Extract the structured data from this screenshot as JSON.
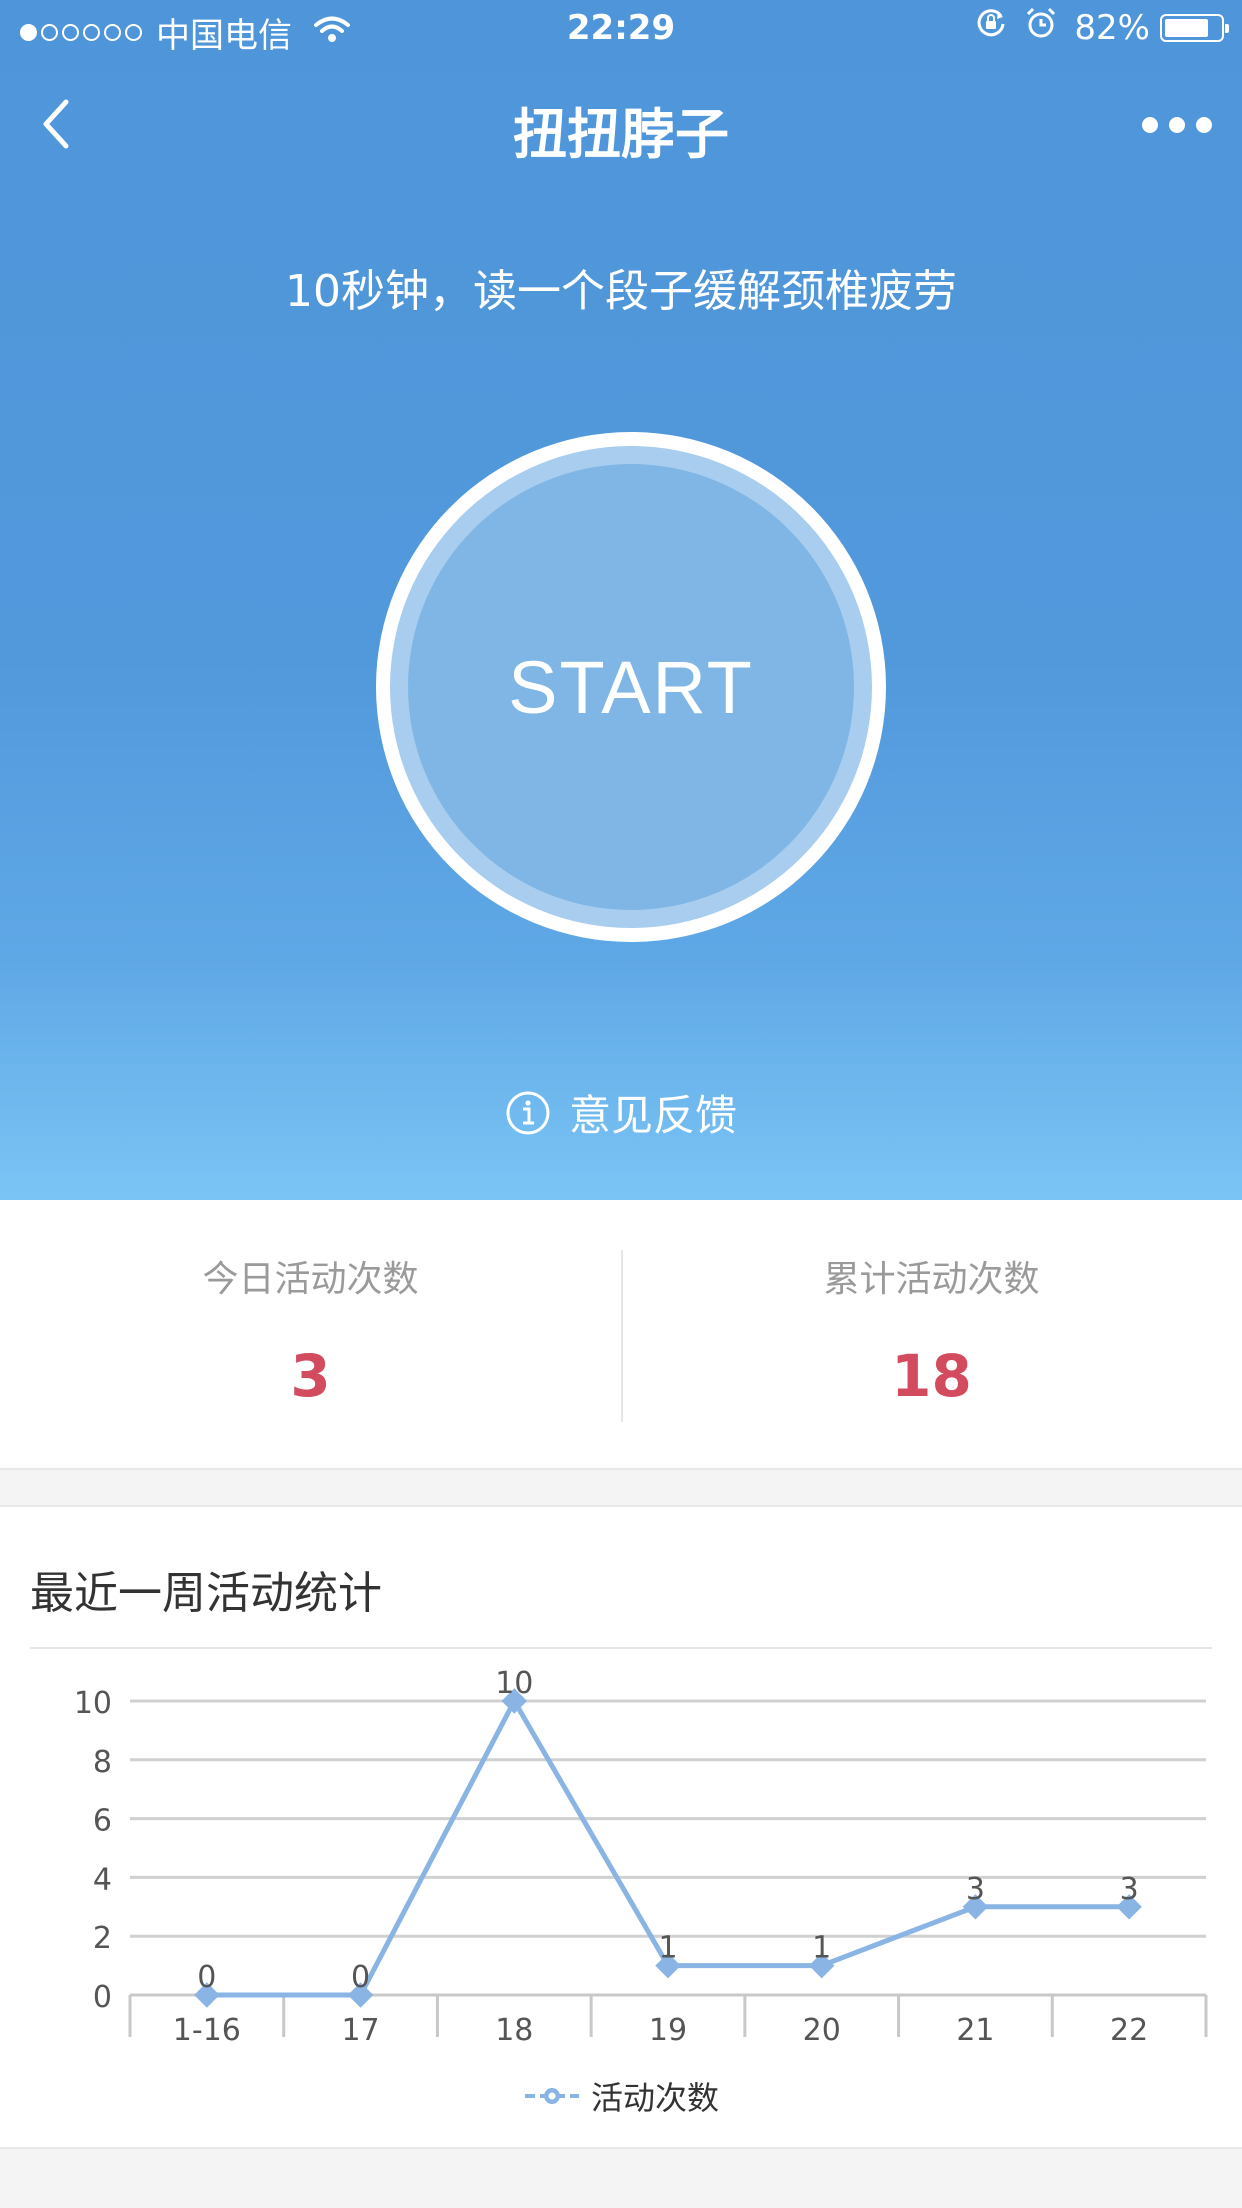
{
  "status_bar": {
    "carrier": "中国电信",
    "time": "22:29",
    "battery_percent": "82%",
    "battery_level": 0.82,
    "signal_bars_filled": 1,
    "signal_bars_total": 6
  },
  "nav": {
    "title": "扭扭脖子",
    "back_icon": "chevron-left-icon",
    "more_icon": "more-dots-icon"
  },
  "hero": {
    "subtitle": "10秒钟，读一个段子缓解颈椎疲劳",
    "start_label": "START",
    "feedback_label": "意见反馈",
    "feedback_icon": "info-icon"
  },
  "stats": {
    "today_label": "今日活动次数",
    "today_value": "3",
    "total_label": "累计活动次数",
    "total_value": "18",
    "value_color": "#d24b5f"
  },
  "chart_section": {
    "title": "最近一周活动统计"
  },
  "chart_data": {
    "type": "line",
    "categories": [
      "1-16",
      "17",
      "18",
      "19",
      "20",
      "21",
      "22"
    ],
    "series": [
      {
        "name": "活动次数",
        "values": [
          0,
          0,
          10,
          1,
          1,
          3,
          3
        ]
      }
    ],
    "y_ticks": [
      "0",
      "2",
      "4",
      "6",
      "8",
      "10"
    ],
    "ylim": [
      0,
      10
    ],
    "grid": true,
    "legend_position": "bottom",
    "line_color": "#8ab4e4"
  },
  "colors": {
    "hero_top": "#4f95d9",
    "hero_bottom": "#7ac4f5",
    "accent_red": "#d24b5f"
  }
}
